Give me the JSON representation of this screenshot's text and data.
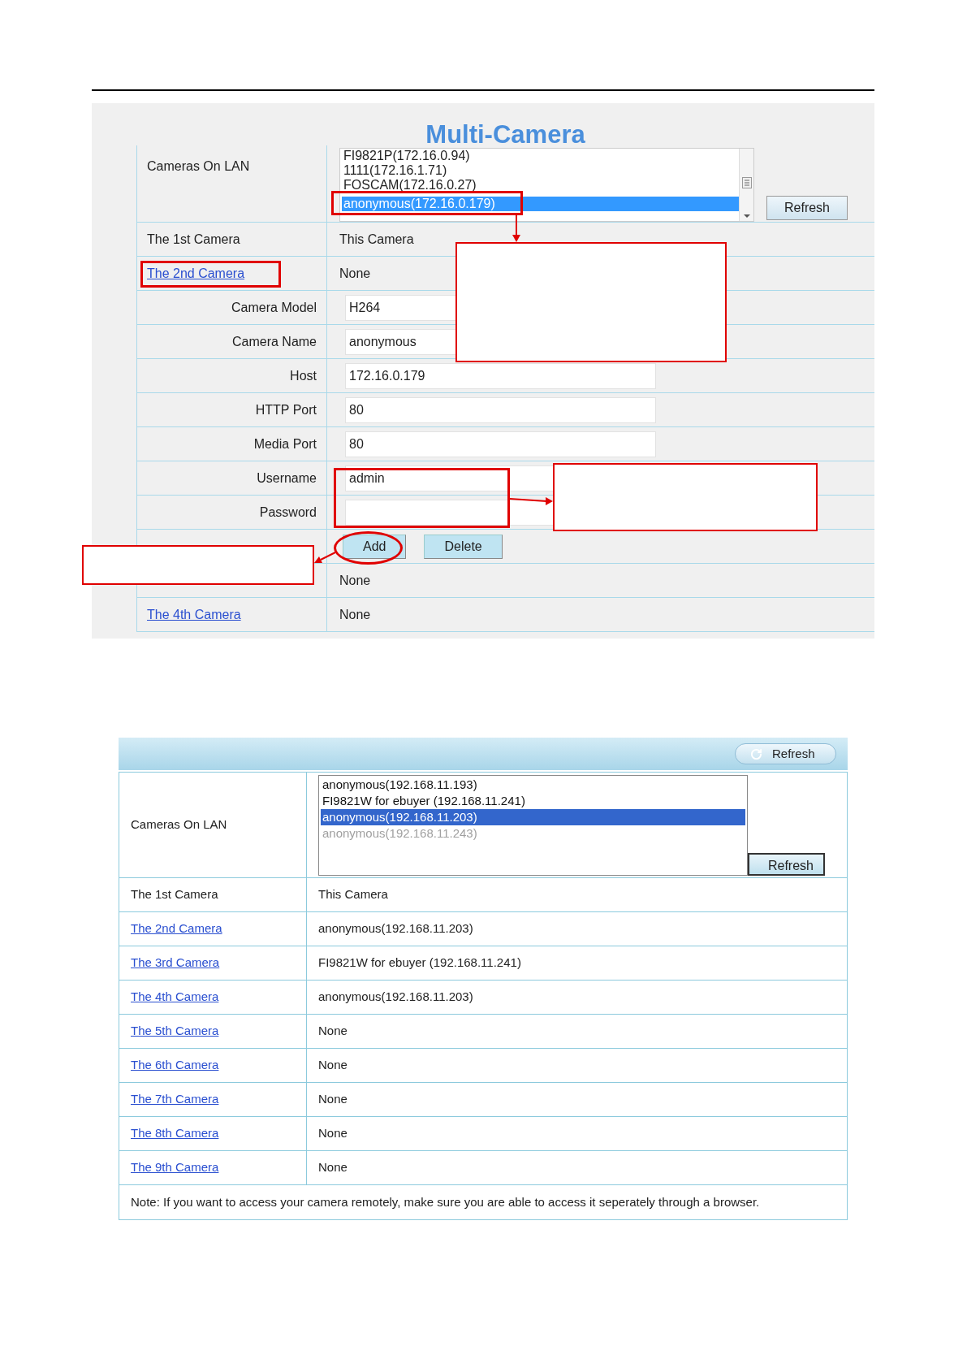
{
  "top_screenshot": {
    "title": "Multi-Camera",
    "cameras_on_lan": {
      "label": "Cameras On LAN",
      "button": "Refresh",
      "items": [
        {
          "text": "FI9821P(172.16.0.94)",
          "selected": false
        },
        {
          "text": "1111(172.16.1.71)",
          "selected": false
        },
        {
          "text": "FOSCAM(172.16.0.27)",
          "selected": false
        },
        {
          "text": "anonymous(172.16.0.179)",
          "selected": true
        }
      ]
    },
    "rows": [
      {
        "kind": "camera",
        "label": "The 1st Camera",
        "link": false,
        "value": "This Camera"
      },
      {
        "kind": "camera",
        "label": "The 2nd Camera",
        "link": true,
        "value": "None"
      },
      {
        "kind": "field",
        "label": "Camera Model",
        "value": "H264"
      },
      {
        "kind": "field",
        "label": "Camera Name",
        "value": "anonymous"
      },
      {
        "kind": "field",
        "label": "Host",
        "value": "172.16.0.179"
      },
      {
        "kind": "field",
        "label": "HTTP Port",
        "value": "80"
      },
      {
        "kind": "field",
        "label": "Media Port",
        "value": "80"
      },
      {
        "kind": "field",
        "label": "Username",
        "value": "admin"
      },
      {
        "kind": "field",
        "label": "Password"
      },
      {
        "kind": "buttons",
        "buttons": [
          "Add",
          "Delete"
        ]
      },
      {
        "kind": "camera",
        "value": "None"
      },
      {
        "kind": "camera",
        "label": "The 4th Camera",
        "link": true,
        "value": "None"
      }
    ]
  },
  "bottom_screenshot": {
    "header_button": "Refresh",
    "cameras_on_lan": {
      "label": "Cameras On LAN",
      "button": "Refresh",
      "items": [
        {
          "text": "anonymous(192.168.11.193)",
          "selected": false,
          "disabled": false
        },
        {
          "text": "FI9821W for ebuyer (192.168.11.241)",
          "selected": false,
          "disabled": false
        },
        {
          "text": "anonymous(192.168.11.203)",
          "selected": true,
          "disabled": false
        },
        {
          "text": "anonymous(192.168.11.243)",
          "selected": false,
          "disabled": true
        }
      ]
    },
    "rows": [
      {
        "label": "The 1st Camera",
        "link": false,
        "value": "This Camera"
      },
      {
        "label": "The 2nd Camera",
        "link": true,
        "value": "anonymous(192.168.11.203)"
      },
      {
        "label": "The 3rd Camera",
        "link": true,
        "value": "FI9821W for ebuyer (192.168.11.241)"
      },
      {
        "label": "The 4th Camera",
        "link": true,
        "value": "anonymous(192.168.11.203)"
      },
      {
        "label": "The 5th Camera",
        "link": true,
        "value": "None"
      },
      {
        "label": "The 6th Camera",
        "link": true,
        "value": "None"
      },
      {
        "label": "The 7th Camera",
        "link": true,
        "value": "None"
      },
      {
        "label": "The 8th Camera",
        "link": true,
        "value": "None"
      },
      {
        "label": "The 9th Camera",
        "link": true,
        "value": "None"
      }
    ],
    "note": "Note: If you want to access your camera remotely, make sure you are able to access it seperately through a browser."
  }
}
